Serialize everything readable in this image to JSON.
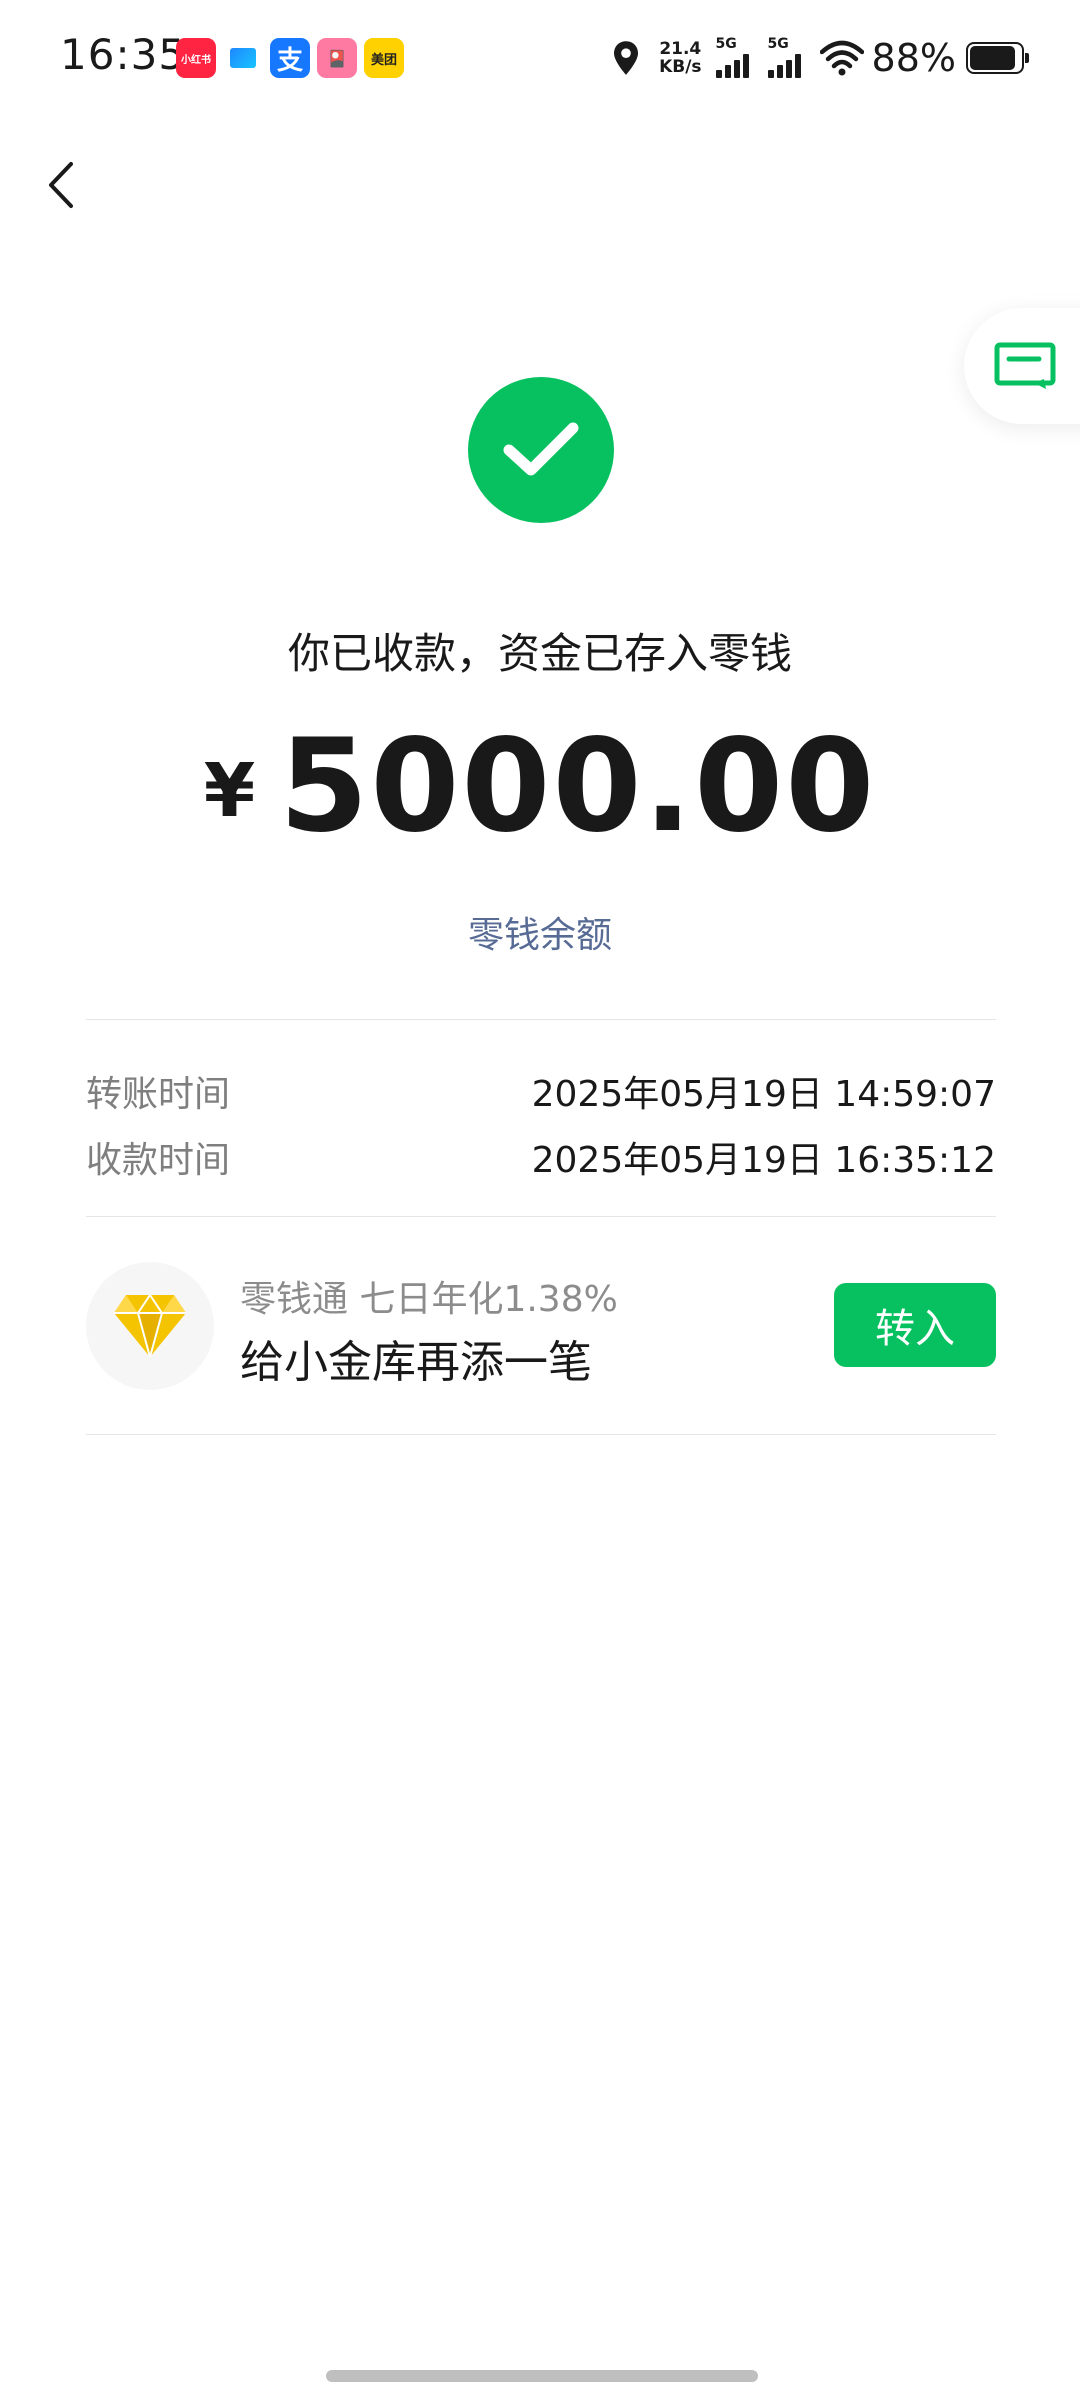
{
  "status_bar": {
    "time": "16:35",
    "app_icons": [
      "小红书",
      "",
      "支",
      "",
      "美团"
    ],
    "net_speed_value": "21.4",
    "net_speed_unit": "KB/s",
    "sim1_label": "5G",
    "sim2_label": "5G",
    "battery_percent": "88%"
  },
  "nav": {
    "back_icon": "chevron-left-icon",
    "float_icon": "message-square-icon"
  },
  "result": {
    "status_icon": "checkmark-icon",
    "headline": "你已收款，资金已存入零钱",
    "currency_symbol": "¥",
    "amount": "5000.00",
    "balance_link": "零钱余额"
  },
  "details": [
    {
      "label": "转账时间",
      "value": "2025年05月19日 14:59:07"
    },
    {
      "label": "收款时间",
      "value": "2025年05月19日 16:35:12"
    }
  ],
  "promo": {
    "icon": "diamond-icon",
    "subtitle": "零钱通 七日年化1.38%",
    "title": "给小金库再添一笔",
    "button_label": "转入"
  },
  "colors": {
    "accent_green": "#07c160",
    "link_blue": "#576b95",
    "diamond_yellow": "#f5c400"
  }
}
